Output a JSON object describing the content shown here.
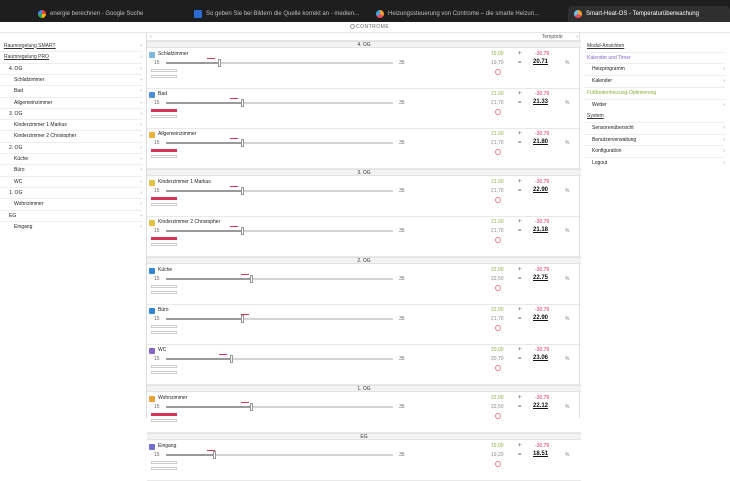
{
  "browser": {
    "tabs": [
      {
        "label": "energie berechnen - Google Suche",
        "icon": "google-icon"
      },
      {
        "label": "So geben Sie bei Bildern die Quelle korrekt an - medien...",
        "icon": "image-icon"
      },
      {
        "label": "Heizungssteuerung von Controme – die smarte Heizun...",
        "icon": "controme-icon"
      },
      {
        "label": "Smart-Heat-OS - Temperaturüberwachung",
        "icon": "controme-icon"
      }
    ]
  },
  "header": {
    "logo": "CONTROME"
  },
  "toolbar": {
    "chevron": "‹",
    "temp_select": "Temporär",
    "sep": "‹"
  },
  "left_nav": {
    "items": [
      {
        "label": "Raumregelung SMART",
        "indent": 0,
        "top": true
      },
      {
        "label": "Raumregelung PRO",
        "indent": 0,
        "top": true
      },
      {
        "label": "4. OG",
        "indent": 1
      },
      {
        "label": "Schlafzimmer",
        "indent": 2
      },
      {
        "label": "Bad",
        "indent": 2
      },
      {
        "label": "Allgemeinzimmer",
        "indent": 2
      },
      {
        "label": "3. OG",
        "indent": 1
      },
      {
        "label": "Kinderzimmer 1 Markus",
        "indent": 2
      },
      {
        "label": "Kinderzimmer 2 Christopher",
        "indent": 2
      },
      {
        "label": "2. OG",
        "indent": 1
      },
      {
        "label": "Küche",
        "indent": 2
      },
      {
        "label": "Büro",
        "indent": 2
      },
      {
        "label": "WC",
        "indent": 2
      },
      {
        "label": "1. OG",
        "indent": 1
      },
      {
        "label": "Wohnzimmer",
        "indent": 2
      },
      {
        "label": "EG",
        "indent": 1
      },
      {
        "label": "Eingang",
        "indent": 2
      }
    ]
  },
  "main": {
    "sections": [
      {
        "title": "4. OG",
        "rooms": [
          {
            "name": "Schlafzimmer",
            "icon": "bed-icon",
            "icon_color": "#7bb8e0",
            "min": "15",
            "max": "35",
            "slider_value": 19.7,
            "marker_value": 19.0,
            "soll": "19.00",
            "soll2": "19.70",
            "limit": "-30.79",
            "actual": "20.71",
            "pct": "%",
            "pink": false
          },
          {
            "name": "Bad",
            "icon": "bath-icon",
            "icon_color": "#4a90d9",
            "min": "15",
            "max": "35",
            "slider_value": 21.7,
            "marker_value": 21.0,
            "soll": "21.00",
            "soll2": "21.70",
            "limit": "-30.79",
            "actual": "21.33",
            "pct": "%",
            "pink": true
          },
          {
            "name": "Allgemeinzimmer",
            "icon": "home-icon",
            "icon_color": "#e9b23a",
            "min": "15",
            "max": "35",
            "slider_value": 21.7,
            "marker_value": 21.0,
            "soll": "21.00",
            "soll2": "21.70",
            "limit": "-30.79",
            "actual": "21.80",
            "pct": "%",
            "pink": true
          }
        ]
      },
      {
        "title": "3. OG",
        "rooms": [
          {
            "name": "Kinderzimmer 1 Markus",
            "icon": "child-icon",
            "icon_color": "#e0c24a",
            "min": "15",
            "max": "35",
            "slider_value": 21.7,
            "marker_value": 21.0,
            "soll": "21.00",
            "soll2": "21.70",
            "limit": "-30.79",
            "actual": "22.90",
            "pct": "%",
            "pink": true
          },
          {
            "name": "Kinderzimmer 2 Christopher",
            "icon": "child-icon",
            "icon_color": "#e0c24a",
            "min": "15",
            "max": "35",
            "slider_value": 21.7,
            "marker_value": 21.0,
            "soll": "21.00",
            "soll2": "21.70",
            "limit": "-30.79",
            "actual": "21.18",
            "pct": "%",
            "pink": true
          }
        ]
      },
      {
        "title": "2. OG",
        "rooms": [
          {
            "name": "Küche",
            "icon": "kitchen-icon",
            "icon_color": "#2f87d6",
            "min": "15",
            "max": "35",
            "slider_value": 22.5,
            "marker_value": 22.0,
            "soll": "22.00",
            "soll2": "22.50",
            "limit": "-30.79",
            "actual": "22.75",
            "pct": "%",
            "pink": false
          },
          {
            "name": "Büro",
            "icon": "office-icon",
            "icon_color": "#2f87d6",
            "min": "15",
            "max": "35",
            "slider_value": 21.7,
            "marker_value": 22.0,
            "soll": "22.00",
            "soll2": "21.70",
            "limit": "-30.79",
            "actual": "22.90",
            "pct": "%",
            "pink": false
          },
          {
            "name": "WC",
            "icon": "wc-icon",
            "icon_color": "#8a63c9",
            "min": "15",
            "max": "35",
            "slider_value": 20.7,
            "marker_value": 20.0,
            "soll": "20.00",
            "soll2": "20.70",
            "limit": "-30.79",
            "actual": "23.06",
            "pct": "%",
            "pink": false
          }
        ]
      },
      {
        "title": "1. OG",
        "rooms": [
          {
            "name": "Wohnzimmer",
            "icon": "sofa-icon",
            "icon_color": "#e9a23a",
            "min": "15",
            "max": "35",
            "slider_value": 22.5,
            "marker_value": 22.0,
            "soll": "22.00",
            "soll2": "22.50",
            "limit": "-30.79",
            "actual": "22.12",
            "pct": "%",
            "pink": true
          }
        ]
      },
      {
        "title": "EG",
        "rooms": [
          {
            "name": "Eingang",
            "icon": "door-icon",
            "icon_color": "#6f6fd0",
            "min": "15",
            "max": "35",
            "slider_value": 19.2,
            "marker_value": 19.0,
            "soll": "19.00",
            "soll2": "19.20",
            "limit": "-30.79",
            "actual": "18.51",
            "pct": "%",
            "pink": false
          }
        ]
      }
    ]
  },
  "right_nav": {
    "items": [
      {
        "label": "Modul-Ansichten",
        "style": "heading"
      },
      {
        "label": "Kalender und Timer",
        "style": "purple"
      },
      {
        "label": "Heizprogramm",
        "style": "sub",
        "arrow": true
      },
      {
        "label": "Kalender",
        "style": "sub",
        "arrow": true
      },
      {
        "label": "Fußbodenheizung-Optimierung",
        "style": "green"
      },
      {
        "label": "Wetter",
        "style": "sub",
        "arrow": true
      },
      {
        "label": "System",
        "style": "heading"
      },
      {
        "label": "Sensorenübersicht",
        "style": "sub",
        "arrow": true
      },
      {
        "label": "Benutzerverwaltung",
        "style": "sub",
        "arrow": true
      },
      {
        "label": "Konfiguration",
        "style": "sub",
        "arrow": true
      },
      {
        "label": "Logout",
        "style": "sub",
        "arrow": true
      }
    ]
  },
  "colors": {
    "accent_pink": "#d63356",
    "green": "#8ab040",
    "purple": "#8a63c9"
  }
}
